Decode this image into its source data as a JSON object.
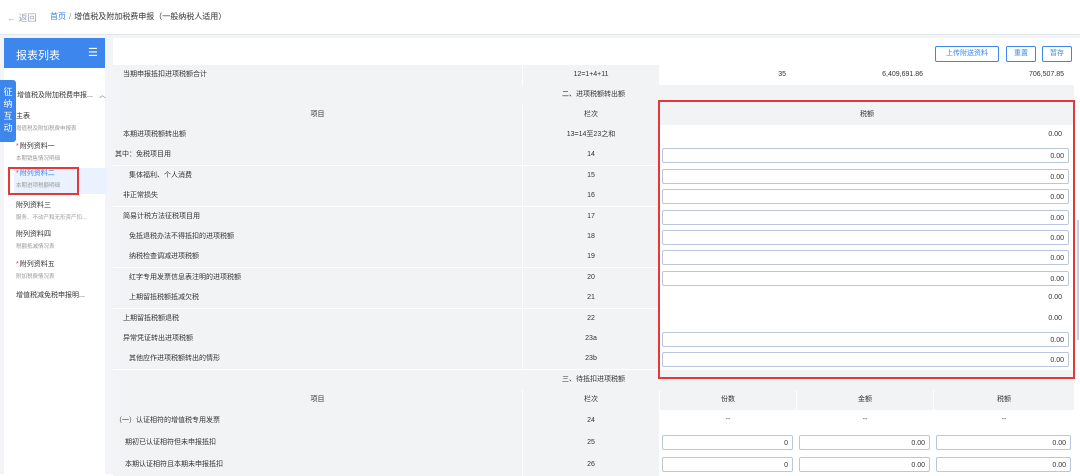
{
  "topbar": {
    "back": "返回",
    "home": "首页",
    "sep": "/",
    "title": "增值税及附加税费申报（一般纳税人适用）"
  },
  "sidebar": {
    "title": "报表列表",
    "menu_icon": "hamburger-menu-icon",
    "float_tab": "征纳互动",
    "group": "增值税及附加税费申报...",
    "items": [
      {
        "label": "主表",
        "sub": "增值税及附加税费申报表",
        "star": ""
      },
      {
        "label": "附列资料一",
        "sub": "本期销售情况明细",
        "star": "*"
      },
      {
        "label": "附列资料二",
        "sub": "本期进项税额明细",
        "star": "*"
      },
      {
        "label": "附列资料三",
        "sub": "服务、不动产和无形资产扣...",
        "star": ""
      },
      {
        "label": "附列资料四",
        "sub": "税额抵减情况表",
        "star": ""
      },
      {
        "label": "附列资料五",
        "sub": "附加税费情况表",
        "star": "*"
      },
      {
        "label": "增值税减免税申报明...",
        "sub": "",
        "star": ""
      }
    ]
  },
  "buttons": {
    "upload": "上传附送资料",
    "reset": "重置",
    "save": "暂存"
  },
  "table": {
    "top_row": {
      "label": "当期申报抵扣进项税额合计",
      "col": "12=1+4+11",
      "v1": "35",
      "v2": "6,409,691.86",
      "v3": "706,507.85"
    },
    "section2": "二、进项税额转出额",
    "head2": {
      "item": "项目",
      "col": "栏次",
      "amt": "税额"
    },
    "rows2": [
      {
        "label": "本期进项税额转出额",
        "col": "13=14至23之和",
        "val": "0.00",
        "input": false
      },
      {
        "label": "其中：免税项目用",
        "col": "14",
        "val": "0.00",
        "input": true
      },
      {
        "label": "集体福利、个人消费",
        "col": "15",
        "val": "0.00",
        "input": true
      },
      {
        "label": "非正常损失",
        "col": "16",
        "val": "0.00",
        "input": true
      },
      {
        "label": "简易计税方法征税项目用",
        "col": "17",
        "val": "0.00",
        "input": true
      },
      {
        "label": "免抵退税办法不得抵扣的进项税额",
        "col": "18",
        "val": "0.00",
        "input": true
      },
      {
        "label": "纳税检查调减进项税额",
        "col": "19",
        "val": "0.00",
        "input": true
      },
      {
        "label": "红字专用发票信息表注明的进项税额",
        "col": "20",
        "val": "0.00",
        "input": true
      },
      {
        "label": "上期留抵税额抵减欠税",
        "col": "21",
        "val": "0.00",
        "input": false
      },
      {
        "label": "上期留抵税额退税",
        "col": "22",
        "val": "0.00",
        "input": false
      },
      {
        "label": "异常凭证转出进项税额",
        "col": "23a",
        "val": "0.00",
        "input": true
      },
      {
        "label": "其他应作进项税额转出的情形",
        "col": "23b",
        "val": "0.00",
        "input": true
      }
    ],
    "section3": "三、待抵扣进项税额",
    "head3": {
      "item": "项目",
      "col": "栏次",
      "c1": "份数",
      "c2": "金额",
      "c3": "税额"
    },
    "rows3": [
      {
        "label": "（一）认证相符的增值税专用发票",
        "col": "24",
        "c1": "--",
        "c2": "--",
        "c3": "--",
        "input": false
      },
      {
        "label": "期初已认证相符但未申报抵扣",
        "col": "25",
        "c1": "0",
        "c2": "0.00",
        "c3": "0.00",
        "input": true
      },
      {
        "label": "本期认证相符且本期未申报抵扣",
        "col": "26",
        "c1": "0",
        "c2": "0.00",
        "c3": "0.00",
        "input": true
      }
    ]
  }
}
